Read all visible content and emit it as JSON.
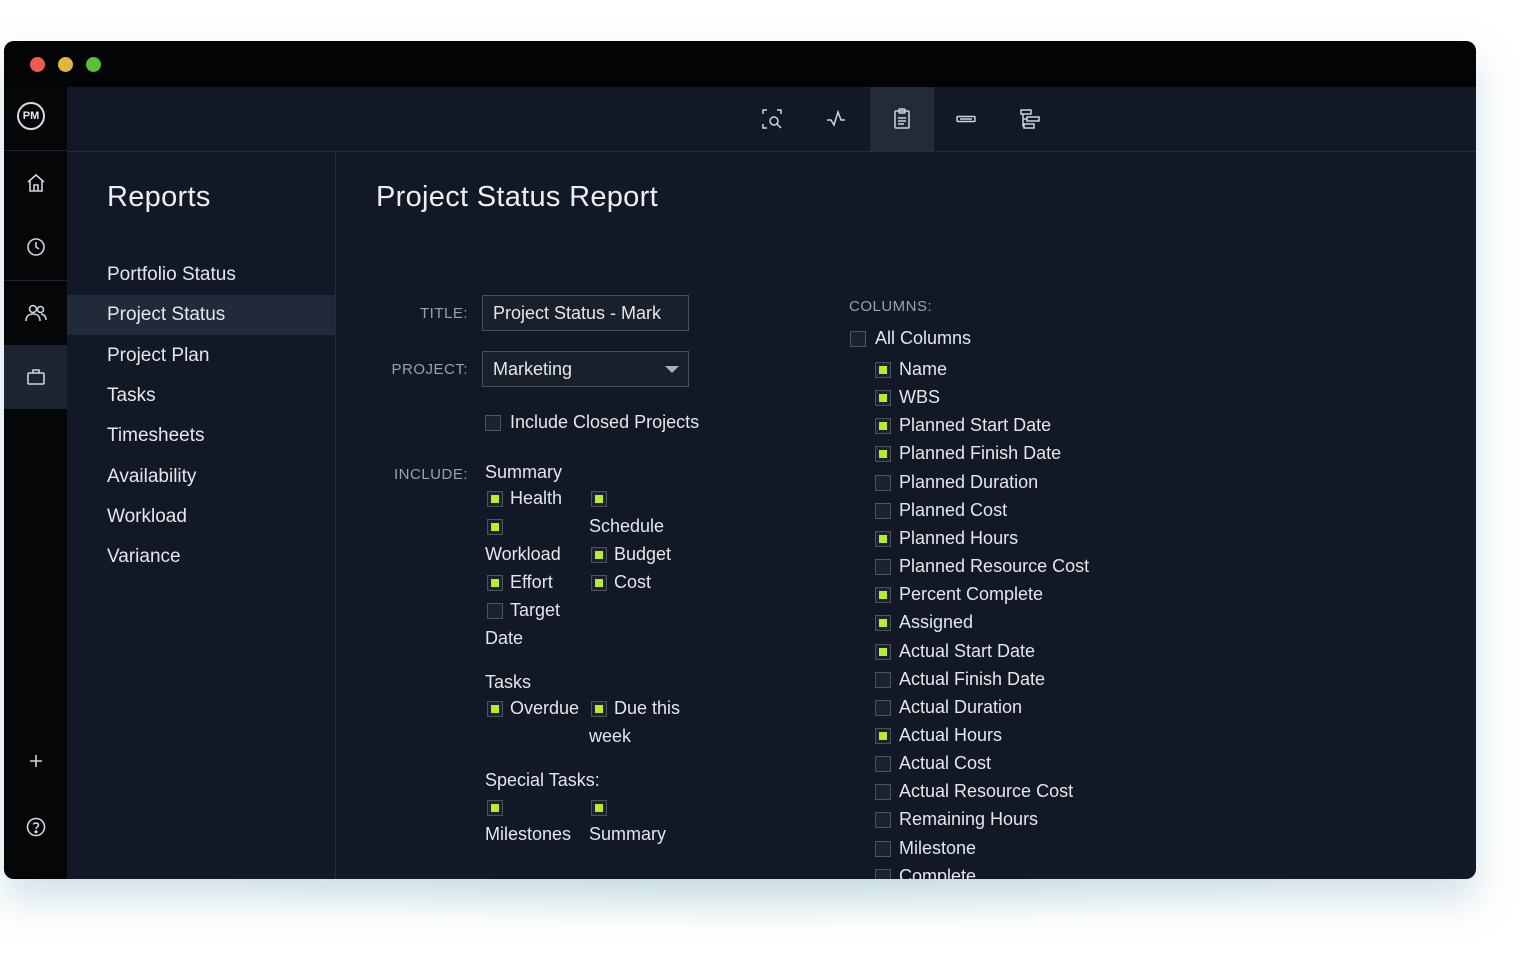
{
  "window": {
    "controls": {
      "close": "#ef5c4f",
      "minimize": "#ddb839",
      "maximize": "#56c036"
    }
  },
  "rail": {
    "logo": "PM",
    "items": [
      {
        "icon": "home-icon"
      },
      {
        "icon": "clock-icon"
      },
      {
        "icon": "people-icon"
      },
      {
        "icon": "briefcase-icon",
        "active": true
      }
    ],
    "bottom": [
      {
        "icon": "plus-icon"
      },
      {
        "icon": "help-icon"
      },
      {
        "icon": "user-avatar"
      }
    ]
  },
  "toolbar": {
    "icons": [
      "zoom-selection-icon",
      "pulse-icon",
      "clipboard-icon",
      "bar-icon",
      "hierarchy-icon"
    ],
    "active": "clipboard-icon"
  },
  "sidebar": {
    "title": "Reports",
    "items": [
      {
        "label": "Portfolio Status"
      },
      {
        "label": "Project Status",
        "active": true
      },
      {
        "label": "Project Plan"
      },
      {
        "label": "Tasks"
      },
      {
        "label": "Timesheets"
      },
      {
        "label": "Availability"
      },
      {
        "label": "Workload"
      },
      {
        "label": "Variance"
      }
    ]
  },
  "report": {
    "heading": "Project Status Report",
    "title_label": "TITLE:",
    "title_value": "Project Status - Mark",
    "project_label": "PROJECT:",
    "project_value": "Marketing",
    "include_closed": {
      "label": "Include Closed Projects",
      "checked": false
    },
    "include_label": "INCLUDE:",
    "summary": {
      "heading": "Summary",
      "health": {
        "label": "Health",
        "checked": true
      },
      "schedule": {
        "label": "Schedule",
        "checked": true
      },
      "workload": {
        "label": "Workload",
        "checked": true
      },
      "budget": {
        "label": "Budget",
        "checked": true
      },
      "effort": {
        "label": "Effort",
        "checked": true
      },
      "cost": {
        "label": "Cost",
        "checked": true
      },
      "target_a": "Target",
      "target_b": "Date",
      "target_checked": false
    },
    "tasks": {
      "heading": "Tasks",
      "overdue": {
        "label": "Overdue",
        "checked": true
      },
      "due_a": "Due this",
      "due_b": "week",
      "due_checked": true
    },
    "special": {
      "heading": "Special Tasks:",
      "milestones": {
        "label": "Milestones",
        "checked": true
      },
      "summary": {
        "label": "Summary",
        "checked": true
      }
    },
    "columns_label": "COLUMNS:",
    "all_columns": {
      "label": "All Columns",
      "checked": false
    },
    "columns": [
      {
        "label": "Name",
        "checked": true
      },
      {
        "label": "WBS",
        "checked": true
      },
      {
        "label": "Planned Start Date",
        "checked": true
      },
      {
        "label": "Planned Finish Date",
        "checked": true
      },
      {
        "label": "Planned Duration",
        "checked": false
      },
      {
        "label": "Planned Cost",
        "checked": false
      },
      {
        "label": "Planned Hours",
        "checked": true
      },
      {
        "label": "Planned Resource Cost",
        "checked": false
      },
      {
        "label": "Percent Complete",
        "checked": true
      },
      {
        "label": "Assigned",
        "checked": true
      },
      {
        "label": "Actual Start Date",
        "checked": true
      },
      {
        "label": "Actual Finish Date",
        "checked": false
      },
      {
        "label": "Actual Duration",
        "checked": false
      },
      {
        "label": "Actual Hours",
        "checked": true
      },
      {
        "label": "Actual Cost",
        "checked": false
      },
      {
        "label": "Actual Resource Cost",
        "checked": false
      },
      {
        "label": "Remaining Hours",
        "checked": false
      },
      {
        "label": "Milestone",
        "checked": false
      },
      {
        "label": "Complete",
        "checked": false
      }
    ],
    "check_color": "#b6ee2b"
  }
}
